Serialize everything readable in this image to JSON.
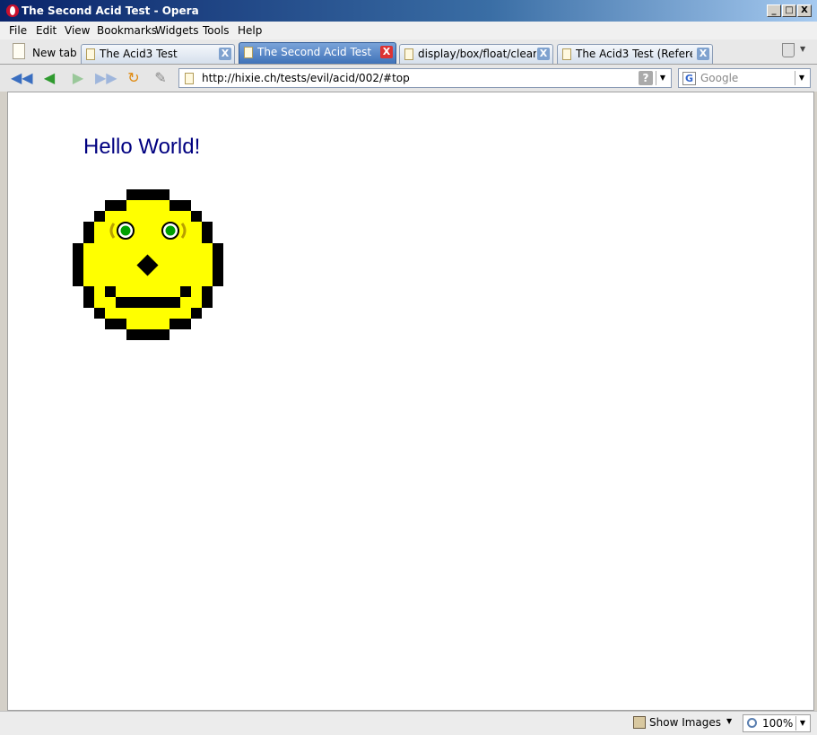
{
  "window": {
    "title": "The Second Acid Test - Opera",
    "controls": {
      "minimize": "_",
      "maximize": "□",
      "close": "X"
    }
  },
  "menu": {
    "items": [
      "File",
      "Edit",
      "View",
      "Bookmarks",
      "Widgets",
      "Tools",
      "Help"
    ]
  },
  "tabs": {
    "new_tab": "New tab",
    "items": [
      {
        "label": "The Acid3 Test",
        "active": false
      },
      {
        "label": "The Second Acid Test",
        "active": true
      },
      {
        "label": "display/box/float/clear ...",
        "active": false
      },
      {
        "label": "The Acid3 Test (Refere...",
        "active": false
      }
    ],
    "close_glyph": "X"
  },
  "toolbar": {
    "back_icon": "rewind-icon",
    "address": "http://hixie.ch/tests/evil/acid/002/#top",
    "help_glyph": "?",
    "search_placeholder": "Google",
    "search_engine_glyph": "G"
  },
  "page": {
    "heading": "Hello World!"
  },
  "statusbar": {
    "show_images": "Show Images",
    "zoom": "100%"
  },
  "colors": {
    "heading": "#000080",
    "smiley_fill": "#ffff00",
    "eye_iris": "#00a000",
    "eyebrow": "#b8a000"
  }
}
